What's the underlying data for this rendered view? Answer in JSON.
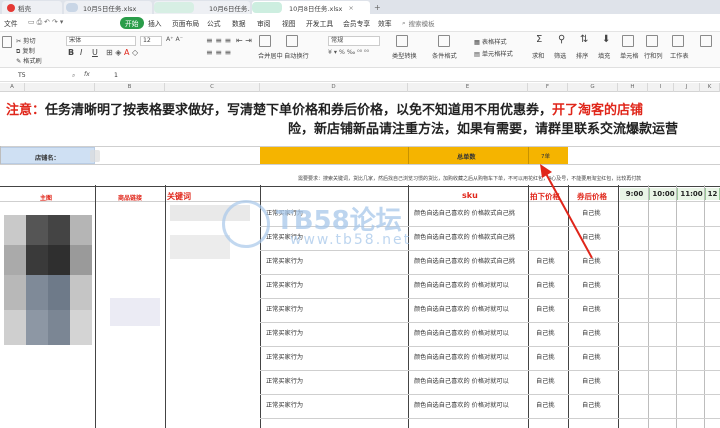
{
  "tabs": [
    {
      "label": "稻壳"
    },
    {
      "label": "10月5日任务.xlsx"
    },
    {
      "label": "10月6日任务.xlsx"
    },
    {
      "label": "10月8日任务.xlsx"
    }
  ],
  "menu": {
    "file": "文件",
    "items": [
      "开始",
      "插入",
      "页面布局",
      "公式",
      "数据",
      "审阅",
      "视图",
      "开发工具",
      "会员专享",
      "效率"
    ],
    "search": "搜索模板"
  },
  "ribbon": {
    "font_name": "宋体",
    "font_size": "12",
    "format": "常规",
    "bold": "B",
    "italic": "I",
    "underline": "U",
    "items": [
      "剪切",
      "复制",
      "格式刷",
      "合并居中",
      "自动换行",
      "类型转换",
      "条件格式",
      "单元格格式",
      "求和",
      "筛选",
      "排序",
      "填充",
      "单元格",
      "行和列",
      "工作表"
    ],
    "style_a": "表格样式",
    "style_b": "单元格样式"
  },
  "formula_bar": {
    "cell_ref": "T5",
    "fx": "fx",
    "value": "1"
  },
  "columns": [
    "A",
    "B",
    "C",
    "D",
    "E",
    "F",
    "G",
    "H",
    "I",
    "J",
    "K"
  ],
  "notice": {
    "line1_a": "注意：",
    "line1_b": "任务清晰明了按表格要求做好，写清楚下单价格和券后价格，以免不知道用不用优惠券，",
    "line1_c": "开了淘客的店铺",
    "line2": "险，新店铺新品请注重方法，如果有需要，请群里联系交流爆款运营"
  },
  "shop_row": {
    "label": "店铺名：",
    "total_label": "总单数",
    "total_value": "7单"
  },
  "requirements": "需要要求：搜索关键词，货比几家，然后找自己浏览习惯的货比，加购收藏之后从购物车下单，不可以用花红包，4心及号，不能要用淘宝红包，比较再付款",
  "headers": {
    "main_image": "主图",
    "product_link": "商品链接",
    "keyword": "关键词",
    "sku": "sku",
    "order_price": "拍下价格",
    "coupon_price": "券后价格",
    "hours": [
      "9:00",
      "10:00",
      "11:00",
      "12"
    ]
  },
  "rows": [
    {
      "behavior": "正常买家行为",
      "sku": "颜色自选自己喜欢的 价格款式自己挑",
      "order": "",
      "coupon": "自己挑"
    },
    {
      "behavior": "正常买家行为",
      "sku": "颜色自选自己喜欢的 价格款式自己挑",
      "order": "",
      "coupon": "自己挑"
    },
    {
      "behavior": "正常买家行为",
      "sku": "颜色自选自己喜欢的 价格款式自己挑",
      "order": "自己挑",
      "coupon": "自己挑"
    },
    {
      "behavior": "正常买家行为",
      "sku": "颜色自选自己喜欢的 价格对就可以",
      "order": "自己挑",
      "coupon": "自己挑"
    },
    {
      "behavior": "正常买家行为",
      "sku": "颜色自选自己喜欢的 价格对就可以",
      "order": "自己挑",
      "coupon": "自己挑"
    },
    {
      "behavior": "正常买家行为",
      "sku": "颜色自选自己喜欢的 价格对就可以",
      "order": "自己挑",
      "coupon": "自己挑"
    },
    {
      "behavior": "正常买家行为",
      "sku": "颜色自选自己喜欢的 价格对就可以",
      "order": "自己挑",
      "coupon": "自己挑"
    },
    {
      "behavior": "正常买家行为",
      "sku": "颜色自选自己喜欢的 价格对就可以",
      "order": "自己挑",
      "coupon": "自己挑"
    },
    {
      "behavior": "正常买家行为",
      "sku": "颜色自选自己喜欢的 价格对就可以",
      "order": "自己挑",
      "coupon": "自己挑"
    }
  ],
  "watermark": {
    "title": "TB58论坛",
    "url": "www.tb58.net"
  },
  "colors": {
    "start_green": "#2a9d4a",
    "header_gold": "#f5b400",
    "shop_blue": "#cfe0f3",
    "hour_green": "#e9f5e6",
    "notice_red": "#e0261a"
  }
}
